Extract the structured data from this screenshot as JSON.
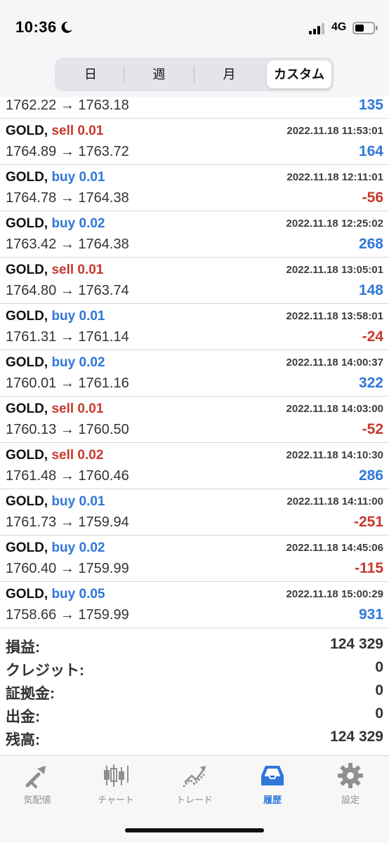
{
  "status_bar": {
    "time": "10:36",
    "network": "4G"
  },
  "segments": [
    "日",
    "週",
    "月",
    "カスタム"
  ],
  "active_segment": "カスタム",
  "partial_row": {
    "prices": "1762.22 → 1763.18",
    "profit": "135"
  },
  "trades": [
    {
      "symbol": "GOLD,",
      "side": "sell",
      "side_text": "sell 0.01",
      "date": "2022.11.18 11:53:01",
      "prices": "1764.89 → 1763.72",
      "profit": "164"
    },
    {
      "symbol": "GOLD,",
      "side": "buy",
      "side_text": "buy 0.01",
      "date": "2022.11.18 12:11:01",
      "prices": "1764.78 → 1764.38",
      "profit": "-56"
    },
    {
      "symbol": "GOLD,",
      "side": "buy",
      "side_text": "buy 0.02",
      "date": "2022.11.18 12:25:02",
      "prices": "1763.42 → 1764.38",
      "profit": "268"
    },
    {
      "symbol": "GOLD,",
      "side": "sell",
      "side_text": "sell 0.01",
      "date": "2022.11.18 13:05:01",
      "prices": "1764.80 → 1763.74",
      "profit": "148"
    },
    {
      "symbol": "GOLD,",
      "side": "buy",
      "side_text": "buy 0.01",
      "date": "2022.11.18 13:58:01",
      "prices": "1761.31 → 1761.14",
      "profit": "-24"
    },
    {
      "symbol": "GOLD,",
      "side": "buy",
      "side_text": "buy 0.02",
      "date": "2022.11.18 14:00:37",
      "prices": "1760.01 → 1761.16",
      "profit": "322"
    },
    {
      "symbol": "GOLD,",
      "side": "sell",
      "side_text": "sell 0.01",
      "date": "2022.11.18 14:03:00",
      "prices": "1760.13 → 1760.50",
      "profit": "-52"
    },
    {
      "symbol": "GOLD,",
      "side": "sell",
      "side_text": "sell 0.02",
      "date": "2022.11.18 14:10:30",
      "prices": "1761.48 → 1760.46",
      "profit": "286"
    },
    {
      "symbol": "GOLD,",
      "side": "buy",
      "side_text": "buy 0.01",
      "date": "2022.11.18 14:11:00",
      "prices": "1761.73 → 1759.94",
      "profit": "-251"
    },
    {
      "symbol": "GOLD,",
      "side": "buy",
      "side_text": "buy 0.02",
      "date": "2022.11.18 14:45:06",
      "prices": "1760.40 → 1759.99",
      "profit": "-115"
    },
    {
      "symbol": "GOLD,",
      "side": "buy",
      "side_text": "buy 0.05",
      "date": "2022.11.18 15:00:29",
      "prices": "1758.66 → 1759.99",
      "profit": "931"
    }
  ],
  "summary": [
    {
      "label": "損益:",
      "value": "124 329"
    },
    {
      "label": "クレジット:",
      "value": "0"
    },
    {
      "label": "証拠金:",
      "value": "0"
    },
    {
      "label": "出金:",
      "value": "0"
    },
    {
      "label": "残高:",
      "value": "124 329"
    }
  ],
  "tabs": [
    {
      "label": "気配値",
      "icon": "quotes-icon"
    },
    {
      "label": "チャート",
      "icon": "chart-icon"
    },
    {
      "label": "トレード",
      "icon": "trade-icon"
    },
    {
      "label": "履歴",
      "icon": "history-icon"
    },
    {
      "label": "設定",
      "icon": "settings-icon"
    }
  ],
  "active_tab": "履歴",
  "colors": {
    "buy": "#2f77d9",
    "sell": "#c8382e",
    "accent": "#2f77d9",
    "inactive": "#8e8e93"
  }
}
